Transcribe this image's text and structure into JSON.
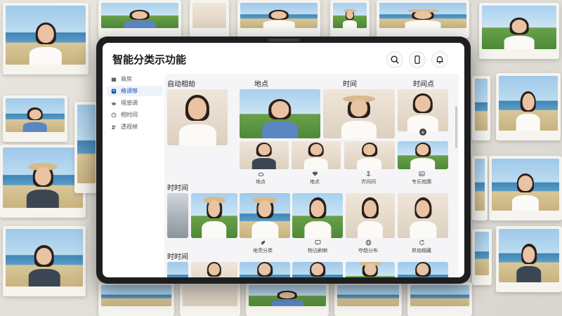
{
  "app": {
    "title": "智能分类示功能"
  },
  "header_icons": [
    "search-icon",
    "phone-icon",
    "bell-icon"
  ],
  "sidebar": {
    "items": [
      {
        "label": "商房",
        "icon": "home-icon",
        "active": false
      },
      {
        "label": "格调够",
        "icon": "album-icon",
        "active": true
      },
      {
        "label": "境感调",
        "icon": "cloud-icon",
        "active": false
      },
      {
        "label": "相时间",
        "icon": "clock-icon",
        "active": false
      },
      {
        "label": "透视帧",
        "icon": "people-icon",
        "active": false
      }
    ]
  },
  "sections": {
    "row1_labels": [
      "自动相劫",
      "地点",
      "时间",
      "时间点"
    ],
    "row2_label": "时时间",
    "row3_label": "时时间"
  },
  "captions": {
    "row1": [
      "地点",
      "地点",
      "岕间间",
      "专乐宛圃"
    ],
    "row2": [
      "地亮分类",
      "物沾刷喇",
      "夺趋分布",
      "昇焰帽藏"
    ]
  },
  "colors": {
    "accent": "#1c55c4",
    "tablet": "#1d1e20",
    "background": "#e3e0d9"
  }
}
